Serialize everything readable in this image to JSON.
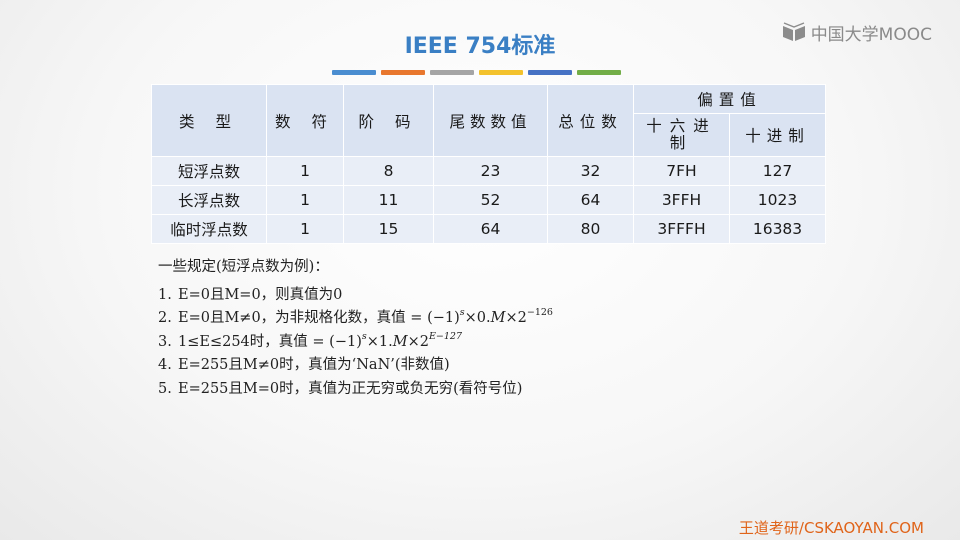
{
  "logo": {
    "text": "中国大学MOOC",
    "icon": "book-icon"
  },
  "title": "IEEE 754标准",
  "title_colors": [
    "#4a8dd0",
    "#e8772e",
    "#a5a5a5",
    "#f3c22d",
    "#4672c4",
    "#72ad47"
  ],
  "table": {
    "headers": {
      "type": "类  型",
      "sign": "数 符",
      "exponent": "阶 码",
      "mantissa": "尾数数值",
      "total": "总位数",
      "bias": "偏置值",
      "bias_hex": "十六进制",
      "bias_dec": "十进制"
    },
    "rows": [
      {
        "type": "短浮点数",
        "sign": "1",
        "exponent": "8",
        "mantissa": "23",
        "total": "32",
        "hex": "7FH",
        "dec": "127"
      },
      {
        "type": "长浮点数",
        "sign": "1",
        "exponent": "11",
        "mantissa": "52",
        "total": "64",
        "hex": "3FFH",
        "dec": "1023"
      },
      {
        "type": "临时浮点数",
        "sign": "1",
        "exponent": "15",
        "mantissa": "64",
        "total": "80",
        "hex": "3FFFH",
        "dec": "16383"
      }
    ]
  },
  "rules": {
    "intro": "一些规定(短浮点数为例)：",
    "items": [
      {
        "num": "1.",
        "text": "E=0且M=0，则真值为0"
      },
      {
        "num": "2.",
        "text": "E=0且M≠0，为非规格化数，真值 = ",
        "formula": "(−1)",
        "sup1": "s",
        "formula2": "×0.",
        "m": "M",
        "formula3": "×2",
        "sup2": "−126"
      },
      {
        "num": "3.",
        "text": "1≤E≤254时，真值 = ",
        "formula": "(−1)",
        "sup1": "s",
        "formula2": "×1.",
        "m": "M",
        "formula3": "×2",
        "sup2": "E−127"
      },
      {
        "num": "4.",
        "text": "E=255且M≠0时，真值为‘NaN’(非数值)"
      },
      {
        "num": "5.",
        "text": "E=255且M=0时，真值为正无穷或负无穷(看符号位)"
      }
    ]
  },
  "footer": "王道考研/CSKAOYAN.COM"
}
